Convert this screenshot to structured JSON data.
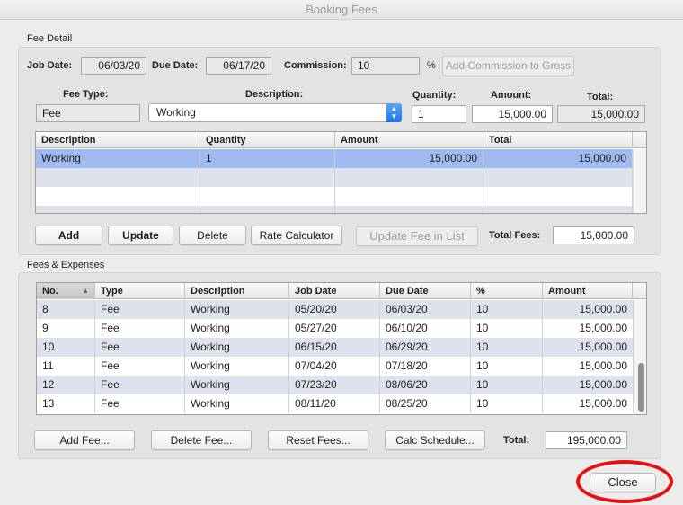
{
  "window": {
    "title": "Booking Fees"
  },
  "fee_detail": {
    "section_label": "Fee Detail",
    "job_date_label": "Job Date:",
    "job_date": "06/03/20",
    "due_date_label": "Due Date:",
    "due_date": "06/17/20",
    "commission_label": "Commission:",
    "commission": "10",
    "percent_sign": "%",
    "add_commission_button": "Add Commission to Gross",
    "fee_type_label": "Fee Type:",
    "fee_type": "Fee",
    "description_label": "Description:",
    "description": "Working",
    "quantity_label": "Quantity:",
    "quantity": "1",
    "amount_label": "Amount:",
    "amount": "15,000.00",
    "total_label": "Total:",
    "total": "15,000.00",
    "table": {
      "columns": [
        "Description",
        "Quantity",
        "Amount",
        "Total"
      ],
      "rows": [
        [
          "Working",
          "1",
          "15,000.00",
          "15,000.00"
        ]
      ]
    },
    "buttons": {
      "add": "Add",
      "update": "Update",
      "delete": "Delete",
      "rate_calculator": "Rate Calculator",
      "update_fee_in_list": "Update Fee in List"
    },
    "total_fees_label": "Total Fees:",
    "total_fees": "15,000.00"
  },
  "fees_expenses": {
    "section_label": "Fees & Expenses",
    "table": {
      "columns": [
        "No.",
        "Type",
        "Description",
        "Job Date",
        "Due Date",
        "%",
        "Amount"
      ],
      "sort_indicator": "▲",
      "rows": [
        [
          "8",
          "Fee",
          "Working",
          "05/20/20",
          "06/03/20",
          "10",
          "15,000.00"
        ],
        [
          "9",
          "Fee",
          "Working",
          "05/27/20",
          "06/10/20",
          "10",
          "15,000.00"
        ],
        [
          "10",
          "Fee",
          "Working",
          "06/15/20",
          "06/29/20",
          "10",
          "15,000.00"
        ],
        [
          "11",
          "Fee",
          "Working",
          "07/04/20",
          "07/18/20",
          "10",
          "15,000.00"
        ],
        [
          "12",
          "Fee",
          "Working",
          "07/23/20",
          "08/06/20",
          "10",
          "15,000.00"
        ],
        [
          "13",
          "Fee",
          "Working",
          "08/11/20",
          "08/25/20",
          "10",
          "15,000.00"
        ]
      ]
    },
    "buttons": {
      "add_fee": "Add Fee...",
      "delete_fee": "Delete Fee...",
      "reset_fees": "Reset Fees...",
      "calc_schedule": "Calc Schedule..."
    },
    "total_label": "Total:",
    "total": "195,000.00"
  },
  "close_button": "Close",
  "colors": {
    "selection": "#9ebaf0",
    "highlight_ring": "#e80f0f",
    "accent": "#1d74e6"
  }
}
